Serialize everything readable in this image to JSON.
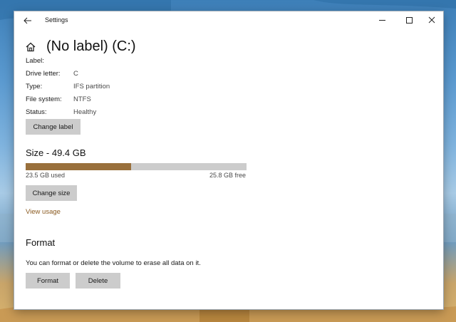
{
  "window": {
    "title": "Settings"
  },
  "page": {
    "title": "(No label) (C:)"
  },
  "properties": [
    {
      "label": "Label:",
      "value": ""
    },
    {
      "label": "Drive letter:",
      "value": "C"
    },
    {
      "label": "Type:",
      "value": "IFS partition"
    },
    {
      "label": "File system:",
      "value": "NTFS"
    },
    {
      "label": "Status:",
      "value": "Healthy"
    }
  ],
  "buttons": {
    "change_label": "Change label",
    "change_size": "Change size",
    "format": "Format",
    "delete": "Delete"
  },
  "size": {
    "heading": "Size - 49.4 GB",
    "used_text": "23.5 GB used",
    "free_text": "25.8 GB free",
    "used_fraction": 0.476,
    "view_usage": "View usage"
  },
  "format": {
    "heading": "Format",
    "description": "You can format or delete the volume to erase all data on it."
  },
  "colors": {
    "accent": "#99703c",
    "bar_track": "#cccccc",
    "button_bg": "#cccccc",
    "link": "#8a5a20"
  },
  "icons": {
    "back": "back-arrow-icon",
    "home": "home-icon",
    "minimize": "minimize-icon",
    "maximize": "maximize-icon",
    "close": "close-icon"
  }
}
